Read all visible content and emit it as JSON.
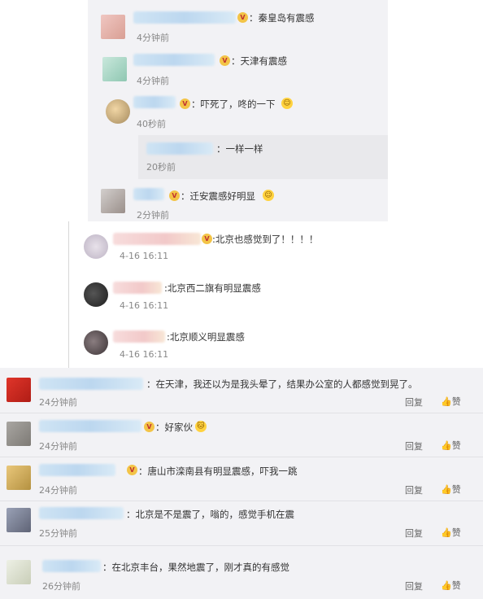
{
  "panel_a": {
    "comments": [
      {
        "text": "：秦皇岛有震感",
        "time": "4分钟前"
      },
      {
        "text": "：天津有震感",
        "time": "4分钟前"
      },
      {
        "text": "：吓死了，咚的一下",
        "time": "40秒前"
      },
      {
        "text": "：迁安震感好明显",
        "time": "2分钟前"
      }
    ],
    "sub_reply": {
      "text": "：一样一样",
      "time": "20秒前"
    }
  },
  "panel_b": {
    "comments": [
      {
        "text": ":北京也感觉到了！！！！",
        "time": "4-16 16:11"
      },
      {
        "text": ":北京西二旗有明显震感",
        "time": "4-16 16:11"
      },
      {
        "text": ":北京顺义明显震感",
        "time": "4-16 16:11"
      }
    ]
  },
  "panel_c": {
    "reply_label": "回复",
    "like_label": "赞",
    "comments": [
      {
        "text": "：在天津，我还以为是我头晕了，结果办公室的人都感觉到晃了。",
        "time": "24分钟前"
      },
      {
        "text": "：好家伙",
        "time": "24分钟前"
      },
      {
        "text": "：唐山市滦南县有明显震感，吓我一跳",
        "time": "24分钟前"
      },
      {
        "text": "：北京是不是震了，嗡的，感觉手机在震",
        "time": "25分钟前"
      },
      {
        "text": "：在北京丰台，果然地震了，刚才真的有感觉",
        "time": "26分钟前"
      }
    ]
  },
  "icons": {
    "like": "thumbs-up-icon",
    "badge": "vip-badge-icon",
    "emoji": "emoji-icon"
  },
  "colors": {
    "panel_bg": "#f2f2f5",
    "time": "#888888",
    "text": "#333333"
  }
}
